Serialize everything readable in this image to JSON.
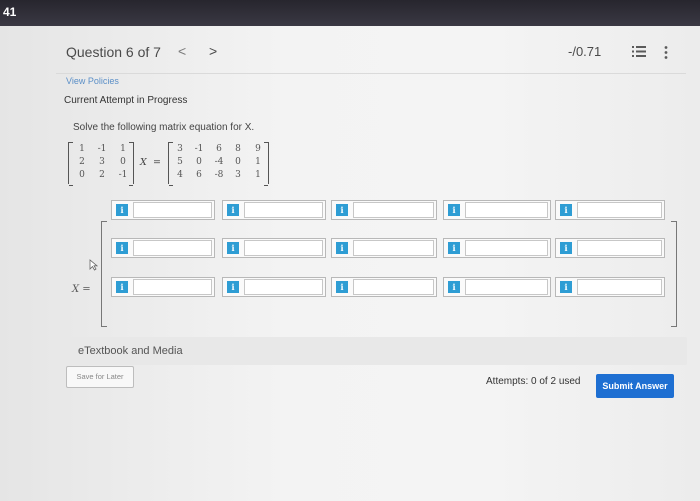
{
  "status_bar": {
    "time": "41"
  },
  "header": {
    "question_label": "Question 6 of 7",
    "prev": "<",
    "next": ">",
    "score": "-/0.71"
  },
  "links": {
    "view_policies": "View Policies"
  },
  "attempt_status": "Current Attempt in Progress",
  "prompt": "Solve the following matrix equation for X.",
  "equation": {
    "left_matrix": [
      [
        "1",
        "-1",
        "1"
      ],
      [
        "2",
        "3",
        "0"
      ],
      [
        "0",
        "2",
        "-1"
      ]
    ],
    "variable": "X",
    "equals": "=",
    "right_matrix": [
      [
        "3",
        "-1",
        "6",
        "8",
        "9"
      ],
      [
        "5",
        "0",
        "-4",
        "0",
        "1"
      ],
      [
        "4",
        "6",
        "-8",
        "3",
        "1"
      ]
    ]
  },
  "answer": {
    "label": "X =",
    "info_glyph": "i",
    "rows": 3,
    "cols": 5,
    "values": [
      [
        "",
        "",
        "",
        "",
        ""
      ],
      [
        "",
        "",
        "",
        "",
        ""
      ],
      [
        "",
        "",
        "",
        "",
        ""
      ]
    ]
  },
  "etextbook": "eTextbook and Media",
  "footer": {
    "save_label": "Save for Later",
    "attempts": "Attempts: 0 of 2 used",
    "submit_label": "Submit Answer"
  },
  "colors": {
    "accent": "#1e6fd2",
    "info": "#2e9dd4",
    "link": "#5b8fc7"
  }
}
